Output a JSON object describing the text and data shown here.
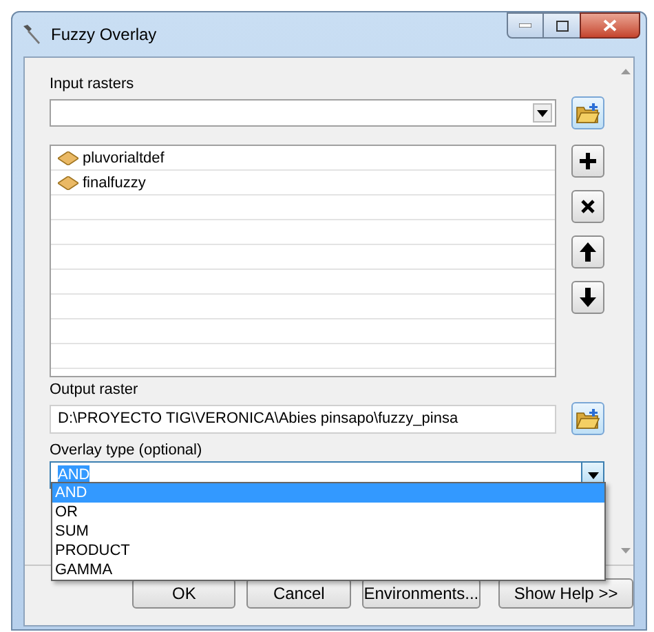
{
  "window": {
    "title": "Fuzzy Overlay"
  },
  "input_rasters": {
    "label": "Input rasters",
    "items": [
      {
        "name": "pluvorialtdef"
      },
      {
        "name": "finalfuzzy"
      }
    ]
  },
  "output_raster": {
    "label": "Output raster",
    "value": "D:\\PROYECTO TIG\\VERONICA\\Abies pinsapo\\fuzzy_pinsa"
  },
  "overlay_type": {
    "label": "Overlay type (optional)",
    "value": "AND",
    "expanded": true,
    "options": [
      {
        "label": "AND",
        "selected": true
      },
      {
        "label": "OR",
        "selected": false
      },
      {
        "label": "SUM",
        "selected": false
      },
      {
        "label": "PRODUCT",
        "selected": false
      },
      {
        "label": "GAMMA",
        "selected": false
      }
    ]
  },
  "buttons": [
    "OK",
    "Cancel",
    "Environments...",
    "Show Help >>"
  ]
}
